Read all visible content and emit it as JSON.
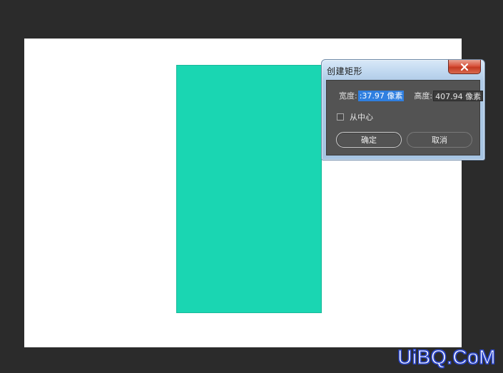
{
  "dialog": {
    "title": "创建矩形",
    "width_label": "宽度:",
    "width_value": ":37.97 像素",
    "height_label": "高度:",
    "height_value": "407.94 像素",
    "from_center_label": "从中心",
    "from_center_checked": false,
    "ok_label": "确定",
    "cancel_label": "取消"
  },
  "canvas": {
    "shape_color": "#1ad6b2",
    "background_color": "#ffffff"
  },
  "watermark": {
    "text": "UiBQ.CoM"
  },
  "icons": {
    "close": "close-icon"
  }
}
